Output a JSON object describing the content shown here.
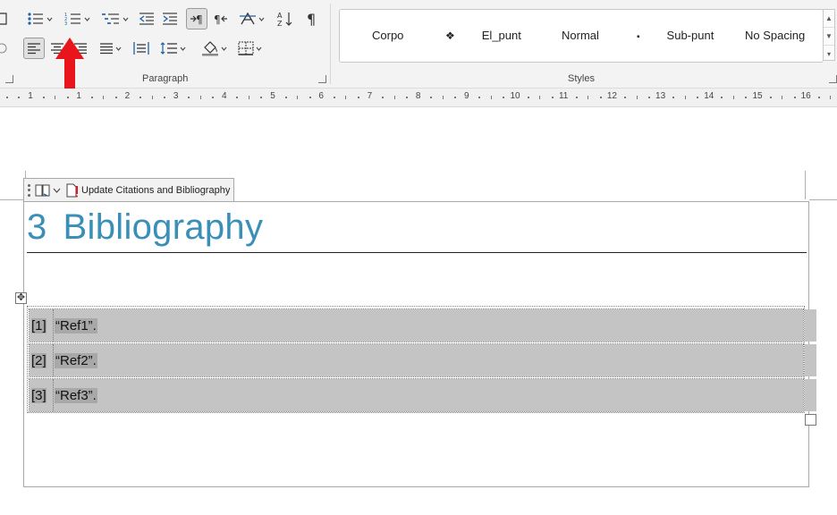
{
  "ribbon": {
    "paragraph_group_label": "Paragraph",
    "styles_group_label": "Styles",
    "styles": [
      {
        "label": "Corpo",
        "marker": ""
      },
      {
        "label": "El_punt",
        "marker": "❖"
      },
      {
        "label": "Normal",
        "marker": ""
      },
      {
        "label": "Sub-punt",
        "marker": "▪"
      },
      {
        "label": "No Spacing",
        "marker": ""
      }
    ]
  },
  "ruler": {
    "numbers": [
      "1",
      "1",
      "2",
      "3",
      "4",
      "5",
      "6",
      "7",
      "8",
      "9",
      "10",
      "11",
      "12",
      "13",
      "14",
      "15",
      "16"
    ]
  },
  "content_control": {
    "update_label": "Update Citations and Bibliography"
  },
  "document": {
    "heading_number": "3",
    "heading_text": "Bibliography",
    "references": [
      {
        "num": "[1]",
        "text": "“Ref1”."
      },
      {
        "num": "[2]",
        "text": "“Ref2”."
      },
      {
        "num": "[3]",
        "text": "“Ref3”."
      }
    ]
  },
  "colors": {
    "heading": "#3a8fb7",
    "annotation_arrow": "#e8161c",
    "row_highlight": "#c4c4c4"
  }
}
